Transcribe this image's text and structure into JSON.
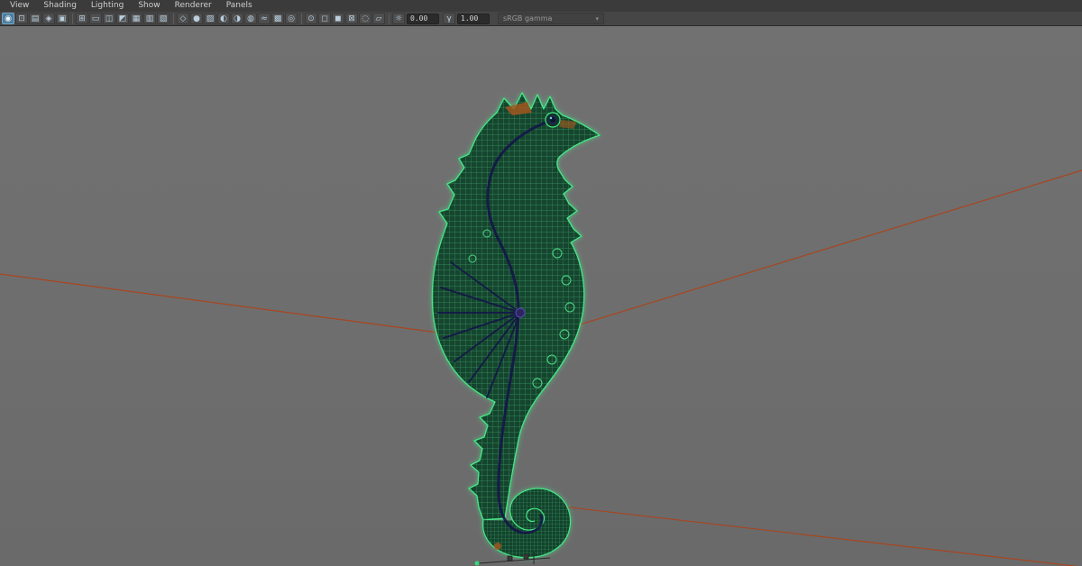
{
  "menubar": {
    "items": [
      {
        "label": "View"
      },
      {
        "label": "Shading"
      },
      {
        "label": "Lighting"
      },
      {
        "label": "Show"
      },
      {
        "label": "Renderer"
      },
      {
        "label": "Panels"
      }
    ]
  },
  "toolbar": {
    "groups": [
      {
        "icons": [
          {
            "name": "select-camera",
            "glyph": "◉",
            "active": true
          },
          {
            "name": "lock-camera",
            "glyph": "⊡"
          },
          {
            "name": "camera-attributes",
            "glyph": "▤"
          },
          {
            "name": "bookmarks",
            "glyph": "◈"
          },
          {
            "name": "image-plane",
            "glyph": "▣"
          }
        ]
      },
      {
        "icons": [
          {
            "name": "grid-toggle",
            "glyph": "⊞"
          },
          {
            "name": "film-gate",
            "glyph": "▭"
          },
          {
            "name": "resolution-gate",
            "glyph": "◫"
          },
          {
            "name": "gate-mask",
            "glyph": "◩"
          },
          {
            "name": "field-chart",
            "glyph": "▦"
          },
          {
            "name": "safe-action",
            "glyph": "▥"
          },
          {
            "name": "safe-title",
            "glyph": "▧"
          }
        ]
      },
      {
        "icons": [
          {
            "name": "wireframe-display",
            "glyph": "◇"
          },
          {
            "name": "smooth-shade",
            "glyph": "●"
          },
          {
            "name": "textured-display",
            "glyph": "▨"
          },
          {
            "name": "use-all-lights",
            "glyph": "◐"
          },
          {
            "name": "shadows-toggle",
            "glyph": "◑"
          },
          {
            "name": "ambient-occlusion",
            "glyph": "◍"
          },
          {
            "name": "motion-blur",
            "glyph": "≈"
          },
          {
            "name": "anti-aliasing",
            "glyph": "▩"
          },
          {
            "name": "depth-of-field",
            "glyph": "◎"
          }
        ]
      },
      {
        "icons": [
          {
            "name": "isolate-select",
            "glyph": "⊙"
          },
          {
            "name": "xray-display",
            "glyph": "◻"
          },
          {
            "name": "xray-joints",
            "glyph": "◼"
          },
          {
            "name": "wireframe-on-shaded",
            "glyph": "⊠"
          },
          {
            "name": "default-material",
            "glyph": "◌"
          },
          {
            "name": "paint-effects-display",
            "glyph": "▱"
          }
        ]
      }
    ],
    "exposure": {
      "icon_glyph": "☼",
      "value": "0.00"
    },
    "gamma": {
      "icon_glyph": "γ",
      "value": "1.00"
    },
    "view_transform": {
      "value": "sRGB gamma",
      "arrow": "▾",
      "disabled": true
    }
  },
  "viewport": {
    "background_color": "#6e6e6e",
    "ground_edge_color": "#a8451f",
    "model": {
      "description": "seahorse wireframe mesh with skeleton joints",
      "wire_color": "#45e886",
      "mesh_fill_color": "#103c28",
      "skeleton_color": "#16164a",
      "accent_color": "#a2571f"
    }
  }
}
